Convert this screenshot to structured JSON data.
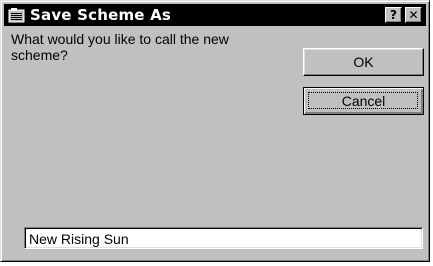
{
  "window": {
    "title": "Save Scheme As",
    "icon": "scheme-folder-icon",
    "help_label": "?",
    "close_label": "✕"
  },
  "prompt": {
    "text": "What would you like to call the new scheme?"
  },
  "buttons": {
    "ok_label": "OK",
    "cancel_label": "Cancel"
  },
  "name_field": {
    "value": "New Rising Sun"
  },
  "colors": {
    "face": "#c0c0c0",
    "titlebar": "#000000",
    "title_text": "#ffffff",
    "field_bg": "#ffffff"
  }
}
